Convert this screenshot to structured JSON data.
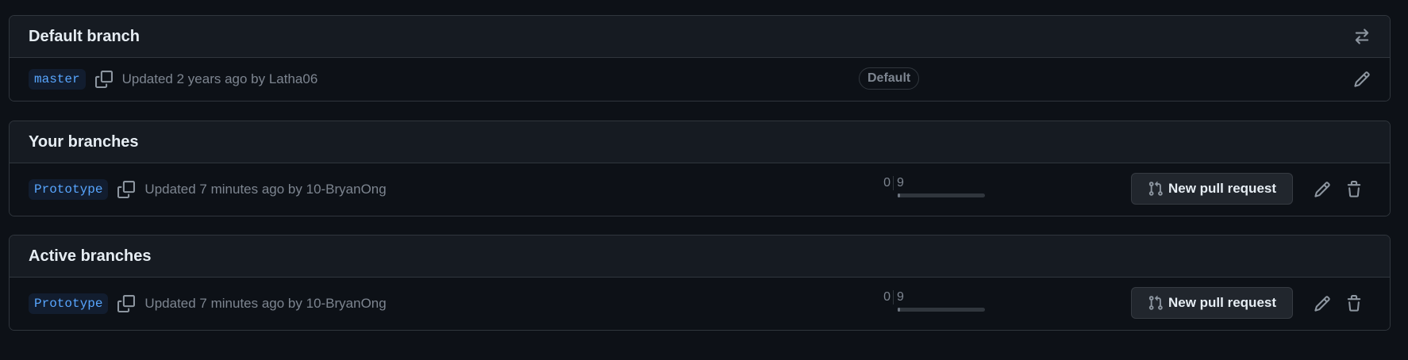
{
  "default_branch": {
    "title": "Default branch",
    "branch": "master",
    "updated_text": "Updated 2 years ago by Latha06",
    "badge": "Default"
  },
  "your_branches": {
    "title": "Your branches",
    "rows": [
      {
        "branch": "Prototype",
        "updated_text": "Updated 7 minutes ago by 10-BryanOng",
        "behind": "0",
        "ahead": "9",
        "ahead_fraction": 0.0,
        "pr_label": "New pull request"
      }
    ]
  },
  "active_branches": {
    "title": "Active branches",
    "rows": [
      {
        "branch": "Prototype",
        "updated_text": "Updated 7 minutes ago by 10-BryanOng",
        "behind": "0",
        "ahead": "9",
        "ahead_fraction": 0.0,
        "pr_label": "New pull request"
      }
    ]
  },
  "colors": {
    "background": "#0d1117",
    "header": "#161b22",
    "border": "#30363d",
    "branch_text": "#58a6ff",
    "muted": "#7d8590"
  },
  "icons": [
    "switch-icon",
    "copy-icon",
    "pencil-icon",
    "trash-icon",
    "git-pull-request-icon"
  ]
}
